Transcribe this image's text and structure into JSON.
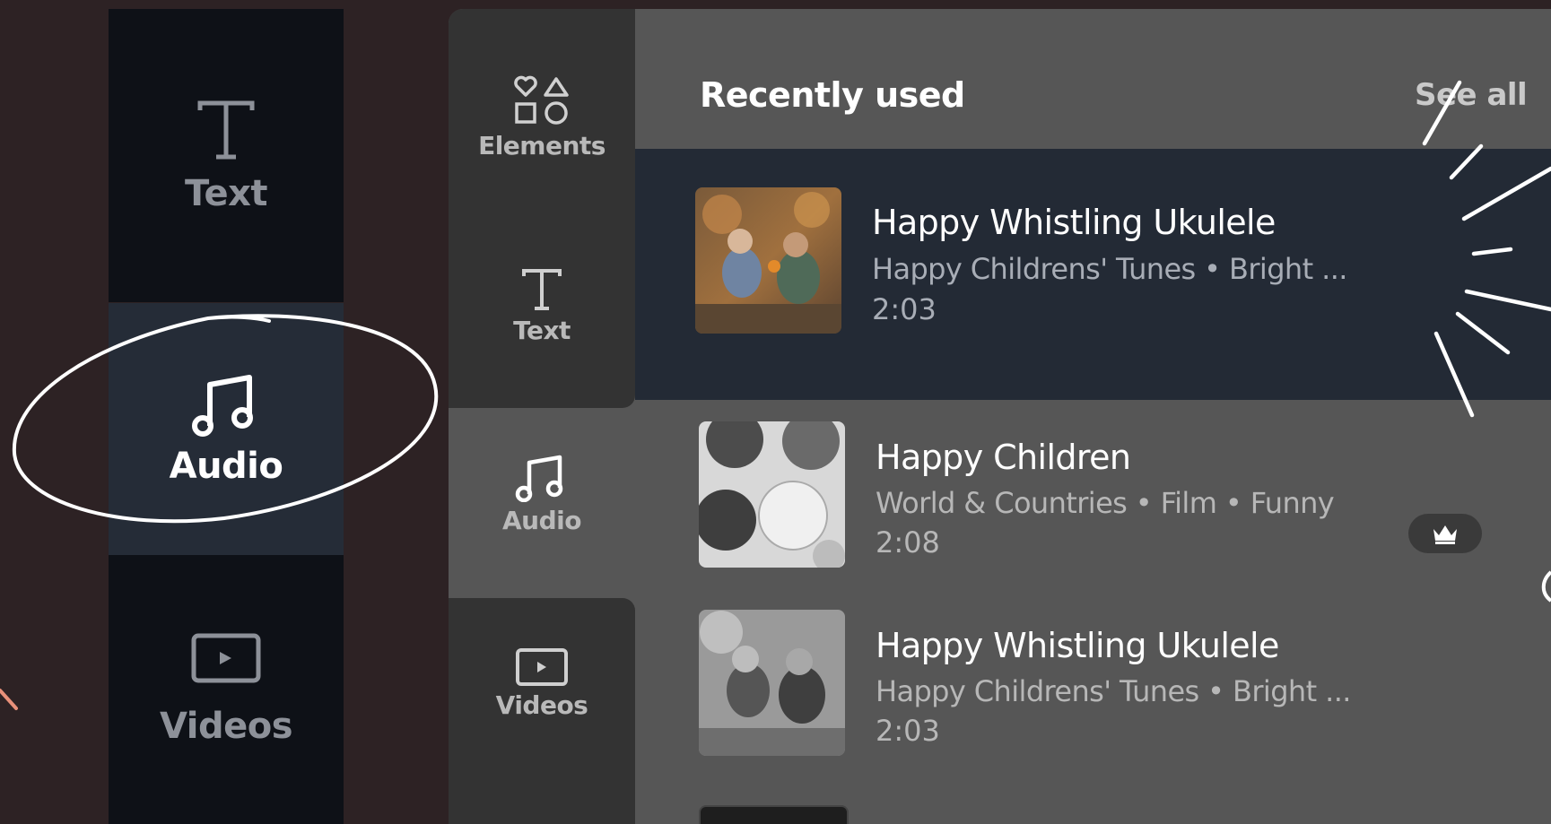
{
  "left_sidebar": {
    "items": [
      {
        "label": "Text",
        "icon": "text-icon"
      },
      {
        "label": "Audio",
        "icon": "music-note-icon",
        "selected": true
      },
      {
        "label": "Videos",
        "icon": "video-icon"
      }
    ]
  },
  "panel": {
    "rail": [
      {
        "label": "Elements",
        "icon": "shapes-icon"
      },
      {
        "label": "Text",
        "icon": "text-icon"
      },
      {
        "label": "Audio",
        "icon": "music-note-icon",
        "selected": true
      },
      {
        "label": "Videos",
        "icon": "video-icon"
      }
    ],
    "header": {
      "title": "Recently used",
      "see_all": "See all"
    },
    "tracks": [
      {
        "title": "Happy Whistling Ukulele",
        "meta": "Happy Childrens' Tunes • Bright ...",
        "duration": "2:03",
        "hovered": true,
        "premium": false
      },
      {
        "title": "Happy Children",
        "meta": "World & Countries • Film • Funny",
        "duration": "2:08",
        "premium": true,
        "badge_icon": "crown-icon"
      },
      {
        "title": "Happy Whistling Ukulele",
        "meta": "Happy Childrens' Tunes • Bright ...",
        "duration": "2:03",
        "premium": false
      }
    ]
  },
  "colors": {
    "background": "#2d2224",
    "sidebar_dark": "#0e1117",
    "sidebar_selected": "#252c37",
    "panel": "#565656",
    "rail": "#333333",
    "track_hover": "#232a35",
    "annotation": "#ffffff",
    "accent_pink": "#e8907a"
  }
}
